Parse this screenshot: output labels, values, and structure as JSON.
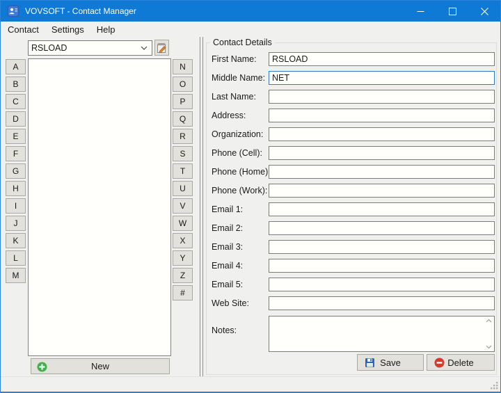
{
  "window": {
    "title": "VOVSOFT - Contact Manager"
  },
  "menu": {
    "items": [
      {
        "label": "Contact"
      },
      {
        "label": "Settings"
      },
      {
        "label": "Help"
      }
    ]
  },
  "sidebar": {
    "contact_selector": {
      "value": "RSLOAD"
    },
    "alpha_left": [
      "A",
      "B",
      "C",
      "D",
      "E",
      "F",
      "G",
      "H",
      "I",
      "J",
      "K",
      "L",
      "M"
    ],
    "alpha_right": [
      "N",
      "O",
      "P",
      "Q",
      "R",
      "S",
      "T",
      "U",
      "V",
      "W",
      "X",
      "Y",
      "Z",
      "#"
    ],
    "new_button_label": "New"
  },
  "details": {
    "group_title": "Contact Details",
    "fields": [
      {
        "label": "First Name:",
        "value": "RSLOAD"
      },
      {
        "label": "Middle Name:",
        "value": "NET"
      },
      {
        "label": "Last Name:",
        "value": ""
      },
      {
        "label": "Address:",
        "value": ""
      },
      {
        "label": "Organization:",
        "value": ""
      },
      {
        "label": "Phone (Cell):",
        "value": ""
      },
      {
        "label": "Phone (Home):",
        "value": ""
      },
      {
        "label": "Phone (Work):",
        "value": ""
      },
      {
        "label": "Email 1:",
        "value": ""
      },
      {
        "label": "Email 2:",
        "value": ""
      },
      {
        "label": "Email 3:",
        "value": ""
      },
      {
        "label": "Email 4:",
        "value": ""
      },
      {
        "label": "Email 5:",
        "value": ""
      },
      {
        "label": "Web Site:",
        "value": ""
      }
    ],
    "notes_label": "Notes:",
    "notes_value": "",
    "save_button_label": "Save",
    "delete_button_label": "Delete"
  },
  "colors": {
    "titlebar": "#0f7ad6",
    "window_border": "#2b84d9",
    "new_icon_green": "#43b14b",
    "save_icon_blue": "#2e62c9",
    "delete_icon_red": "#d63a2a",
    "focus_border": "#2a7cc7",
    "edit_pencil_orange": "#e08a2e"
  }
}
